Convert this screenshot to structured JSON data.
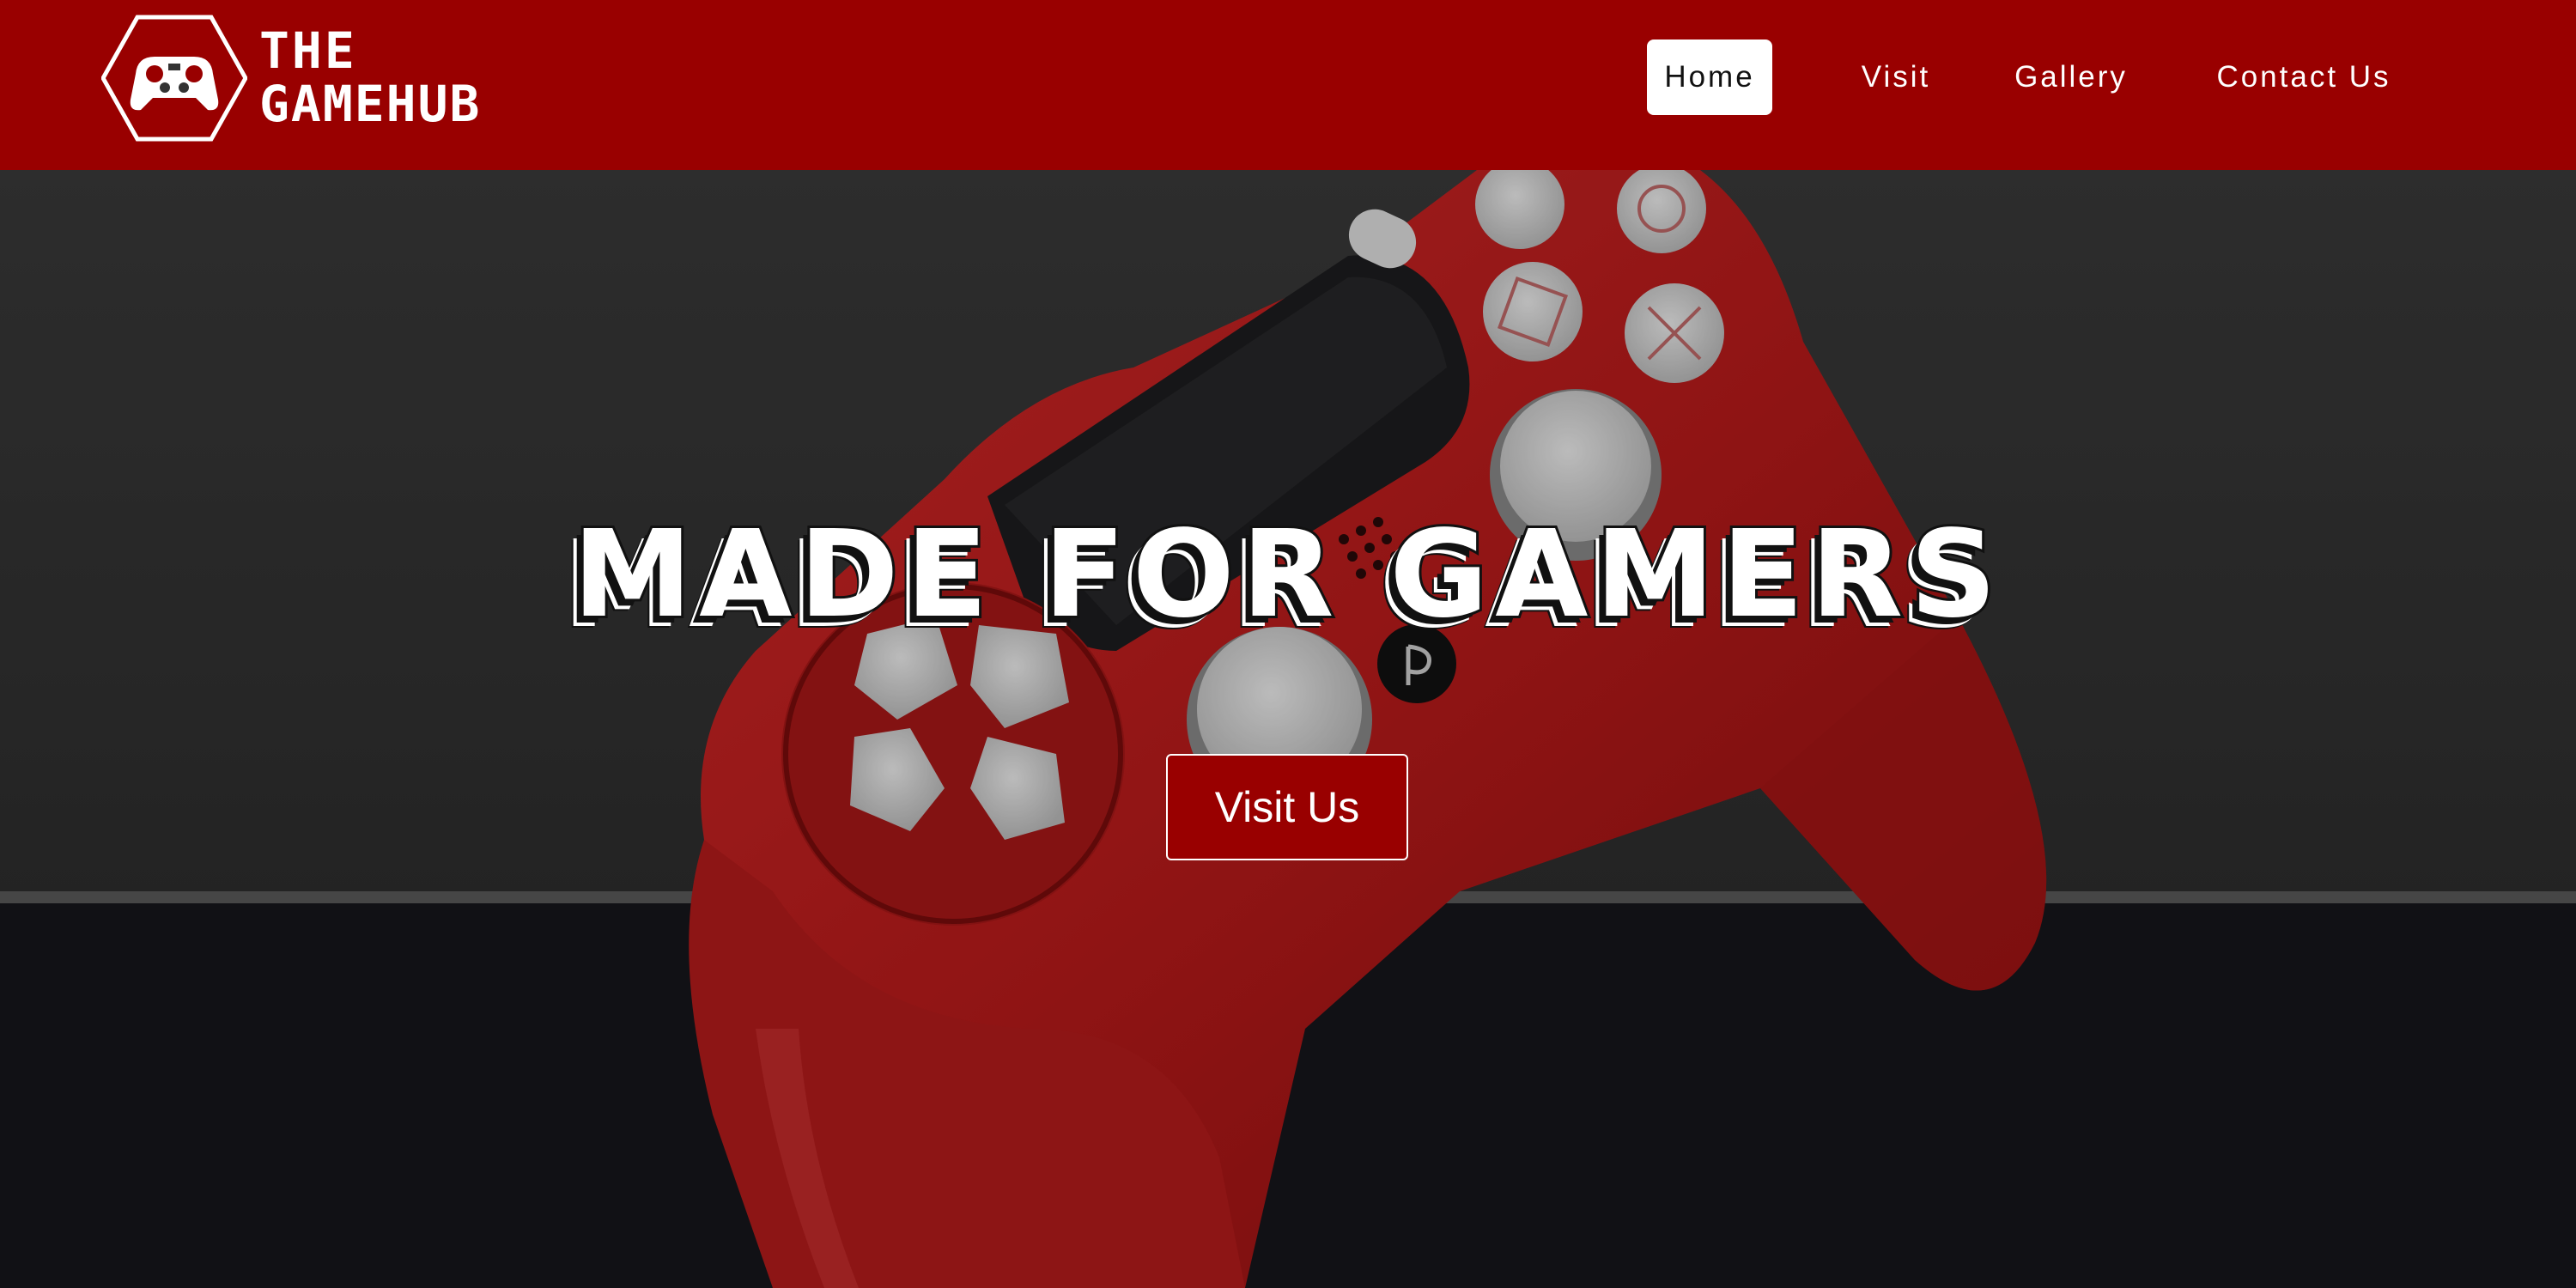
{
  "brand": {
    "line1": "THE",
    "line2": "GAMEHUB",
    "logo_icon": "gamepad-hexagon-icon"
  },
  "nav": {
    "items": [
      {
        "label": "Home",
        "active": true
      },
      {
        "label": "Visit",
        "active": false
      },
      {
        "label": "Gallery",
        "active": false
      },
      {
        "label": "Contact Us",
        "active": false
      }
    ]
  },
  "hero": {
    "title": "MADE FOR GAMERS",
    "button_label": "Visit Us",
    "background": "red-game-controller-photo"
  },
  "colors": {
    "brand_red": "#990000",
    "nav_active_bg": "#ffffff",
    "hero_dark": "#1a1a1c",
    "controller_red": "#c41e1e",
    "button_white": "#d9d9d9"
  }
}
